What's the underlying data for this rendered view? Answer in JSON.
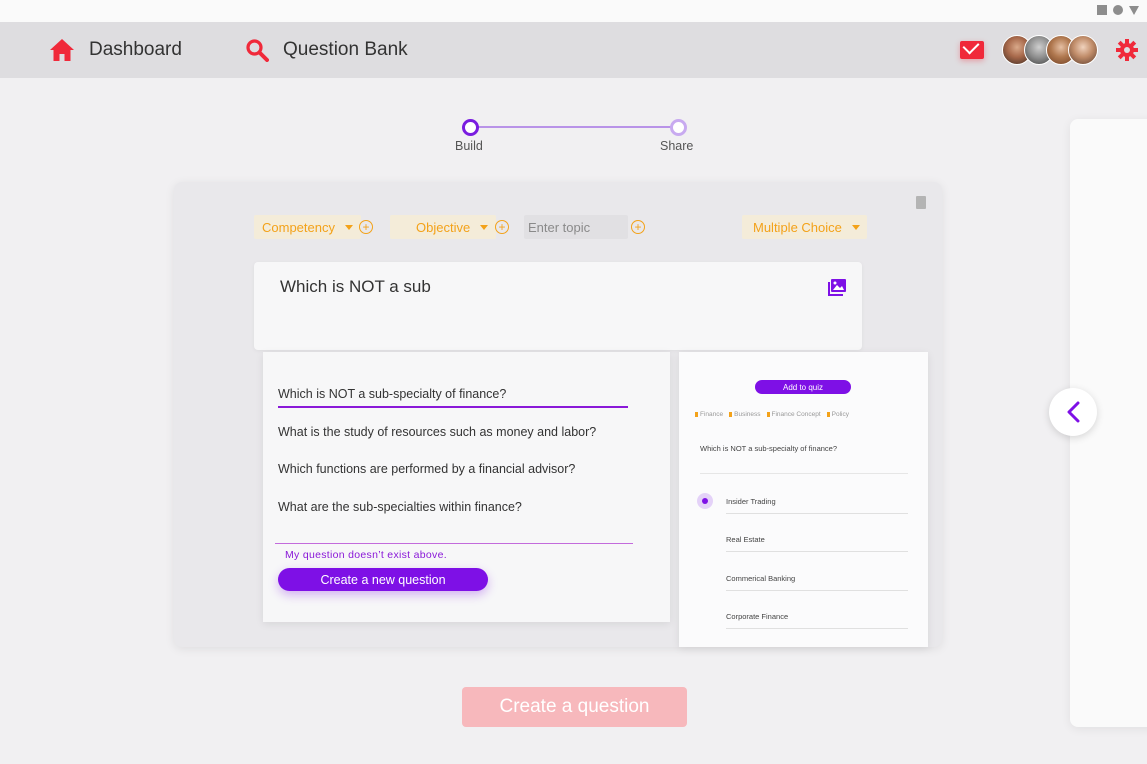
{
  "nav": {
    "dashboard_label": "Dashboard",
    "question_bank_label": "Question Bank",
    "accent": "#f0293a"
  },
  "stepper": {
    "steps": [
      {
        "label": "Build",
        "state": "active"
      },
      {
        "label": "Share",
        "state": "pending"
      }
    ]
  },
  "builder": {
    "competency_label": "Competency",
    "objective_label": "Objective",
    "topic_placeholder": "Enter topic",
    "type_label": "Multiple Choice",
    "question_text": "Which is NOT a sub"
  },
  "suggestions": {
    "items": [
      "Which is NOT a sub-specialty of finance?",
      "What is the study of resources such as money and labor?",
      "Which functions are performed by a financial advisor?",
      "What are the sub-specialties within finance?"
    ],
    "not_exist_text": "My question doesn’t exist above.",
    "create_new_label": "Create a new question"
  },
  "preview": {
    "add_to_quiz_label": "Add to quiz",
    "tags": [
      "Finance",
      "Business",
      "Finance Concept",
      "Policy"
    ],
    "question": "Which is NOT a sub-specialty of finance?",
    "options": [
      "Insider Trading",
      "Real Estate",
      "Commerical Banking",
      "Corporate Finance"
    ],
    "selected_option": "Insider Trading"
  },
  "footer": {
    "create_question_label": "Create a question"
  },
  "colors": {
    "purple": "#7e10e6",
    "orange": "#f3a21a",
    "red": "#f0293a"
  }
}
